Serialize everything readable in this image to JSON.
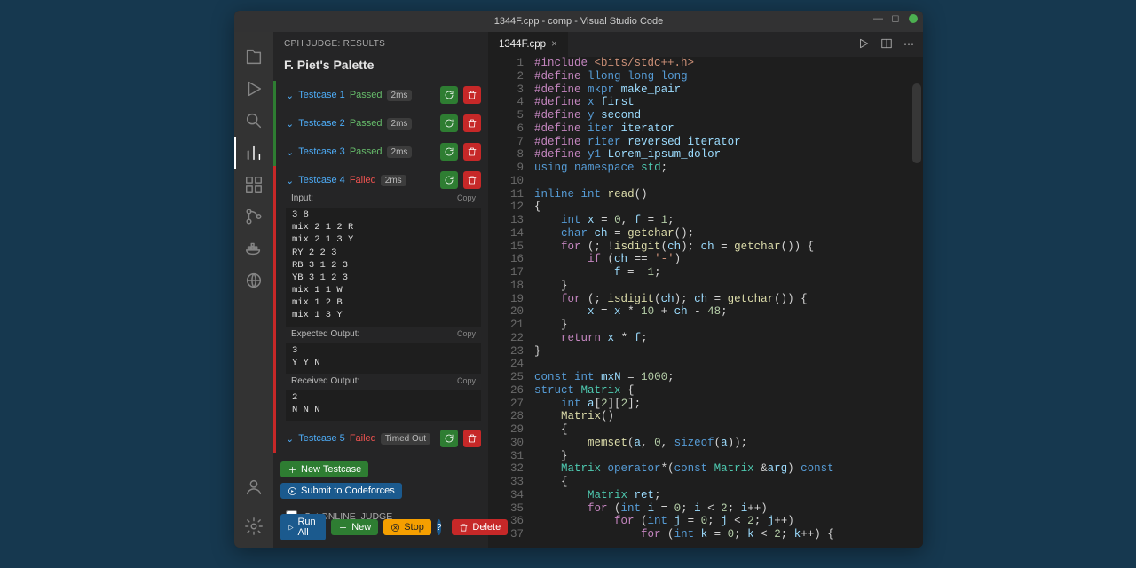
{
  "titlebar": {
    "title": "1344F.cpp - comp - Visual Studio Code"
  },
  "side": {
    "header": "CPH JUDGE: RESULTS",
    "problem": "F. Piet's Palette",
    "testcases": [
      {
        "label": "Testcase 1",
        "status": "Passed",
        "meta": "2ms",
        "pass": true,
        "expanded": false
      },
      {
        "label": "Testcase 2",
        "status": "Passed",
        "meta": "2ms",
        "pass": true,
        "expanded": false
      },
      {
        "label": "Testcase 3",
        "status": "Passed",
        "meta": "2ms",
        "pass": true,
        "expanded": false
      },
      {
        "label": "Testcase 4",
        "status": "Failed",
        "meta": "2ms",
        "pass": false,
        "expanded": true
      },
      {
        "label": "Testcase 5",
        "status": "Failed",
        "meta": "Timed Out",
        "pass": false,
        "expanded": false
      }
    ],
    "tc4": {
      "input_label": "Input:",
      "input": "3 8\nmix 2 1 2 R\nmix 2 1 3 Y\nRY 2 2 3\nRB 3 1 2 3\nYB 3 1 2 3\nmix 1 1 W\nmix 1 2 B\nmix 1 3 Y",
      "expected_label": "Expected Output:",
      "expected": "3\nY Y N",
      "received_label": "Received Output:",
      "received": "2\nN N N",
      "copy": "Copy"
    },
    "new_testcase": "New Testcase",
    "submit": "Submit to Codeforces",
    "checkbox": "Set ONLINE_JUDGE"
  },
  "bottom": {
    "runall": "Run All",
    "new": "New",
    "stop": "Stop",
    "delete": "Delete"
  },
  "tab": {
    "name": "1344F.cpp"
  },
  "code": {
    "lines": [
      [
        {
          "c": "tk-pp",
          "t": "#include"
        },
        {
          "c": "",
          "t": " "
        },
        {
          "c": "tk-st",
          "t": "<bits/stdc++.h>"
        }
      ],
      [
        {
          "c": "tk-pp",
          "t": "#define"
        },
        {
          "c": "",
          "t": " "
        },
        {
          "c": "tk-kw",
          "t": "llong"
        },
        {
          "c": "",
          "t": " "
        },
        {
          "c": "tk-kw",
          "t": "long long"
        }
      ],
      [
        {
          "c": "tk-pp",
          "t": "#define"
        },
        {
          "c": "",
          "t": " "
        },
        {
          "c": "tk-kw",
          "t": "mkpr"
        },
        {
          "c": "",
          "t": " "
        },
        {
          "c": "tk-id",
          "t": "make_pair"
        }
      ],
      [
        {
          "c": "tk-pp",
          "t": "#define"
        },
        {
          "c": "",
          "t": " "
        },
        {
          "c": "tk-kw",
          "t": "x"
        },
        {
          "c": "",
          "t": " "
        },
        {
          "c": "tk-id",
          "t": "first"
        }
      ],
      [
        {
          "c": "tk-pp",
          "t": "#define"
        },
        {
          "c": "",
          "t": " "
        },
        {
          "c": "tk-kw",
          "t": "y"
        },
        {
          "c": "",
          "t": " "
        },
        {
          "c": "tk-id",
          "t": "second"
        }
      ],
      [
        {
          "c": "tk-pp",
          "t": "#define"
        },
        {
          "c": "",
          "t": " "
        },
        {
          "c": "tk-kw",
          "t": "iter"
        },
        {
          "c": "",
          "t": " "
        },
        {
          "c": "tk-id",
          "t": "iterator"
        }
      ],
      [
        {
          "c": "tk-pp",
          "t": "#define"
        },
        {
          "c": "",
          "t": " "
        },
        {
          "c": "tk-kw",
          "t": "riter"
        },
        {
          "c": "",
          "t": " "
        },
        {
          "c": "tk-id",
          "t": "reversed_iterator"
        }
      ],
      [
        {
          "c": "tk-pp",
          "t": "#define"
        },
        {
          "c": "",
          "t": " "
        },
        {
          "c": "tk-kw",
          "t": "y1"
        },
        {
          "c": "",
          "t": " "
        },
        {
          "c": "tk-id",
          "t": "Lorem_ipsum_dolor"
        }
      ],
      [
        {
          "c": "tk-kw",
          "t": "using"
        },
        {
          "c": "",
          "t": " "
        },
        {
          "c": "tk-kw",
          "t": "namespace"
        },
        {
          "c": "",
          "t": " "
        },
        {
          "c": "tk-ty",
          "t": "std"
        },
        {
          "c": "",
          "t": ";"
        }
      ],
      [
        {
          "c": "",
          "t": ""
        }
      ],
      [
        {
          "c": "tk-kw",
          "t": "inline"
        },
        {
          "c": "",
          "t": " "
        },
        {
          "c": "tk-kw",
          "t": "int"
        },
        {
          "c": "",
          "t": " "
        },
        {
          "c": "tk-fn",
          "t": "read"
        },
        {
          "c": "",
          "t": "()"
        }
      ],
      [
        {
          "c": "",
          "t": "{"
        }
      ],
      [
        {
          "c": "",
          "t": "    "
        },
        {
          "c": "tk-kw",
          "t": "int"
        },
        {
          "c": "",
          "t": " "
        },
        {
          "c": "tk-id",
          "t": "x"
        },
        {
          "c": "",
          "t": " = "
        },
        {
          "c": "tk-nm",
          "t": "0"
        },
        {
          "c": "",
          "t": ", "
        },
        {
          "c": "tk-id",
          "t": "f"
        },
        {
          "c": "",
          "t": " = "
        },
        {
          "c": "tk-nm",
          "t": "1"
        },
        {
          "c": "",
          "t": ";"
        }
      ],
      [
        {
          "c": "",
          "t": "    "
        },
        {
          "c": "tk-kw",
          "t": "char"
        },
        {
          "c": "",
          "t": " "
        },
        {
          "c": "tk-id",
          "t": "ch"
        },
        {
          "c": "",
          "t": " = "
        },
        {
          "c": "tk-fn",
          "t": "getchar"
        },
        {
          "c": "",
          "t": "();"
        }
      ],
      [
        {
          "c": "",
          "t": "    "
        },
        {
          "c": "tk-pp",
          "t": "for"
        },
        {
          "c": "",
          "t": " (; !"
        },
        {
          "c": "tk-fn",
          "t": "isdigit"
        },
        {
          "c": "",
          "t": "("
        },
        {
          "c": "tk-id",
          "t": "ch"
        },
        {
          "c": "",
          "t": "); "
        },
        {
          "c": "tk-id",
          "t": "ch"
        },
        {
          "c": "",
          "t": " = "
        },
        {
          "c": "tk-fn",
          "t": "getchar"
        },
        {
          "c": "",
          "t": "()) {"
        }
      ],
      [
        {
          "c": "",
          "t": "        "
        },
        {
          "c": "tk-pp",
          "t": "if"
        },
        {
          "c": "",
          "t": " ("
        },
        {
          "c": "tk-id",
          "t": "ch"
        },
        {
          "c": "",
          "t": " == "
        },
        {
          "c": "tk-st",
          "t": "'-'"
        },
        {
          "c": "",
          "t": ")"
        }
      ],
      [
        {
          "c": "",
          "t": "            "
        },
        {
          "c": "tk-id",
          "t": "f"
        },
        {
          "c": "",
          "t": " = -"
        },
        {
          "c": "tk-nm",
          "t": "1"
        },
        {
          "c": "",
          "t": ";"
        }
      ],
      [
        {
          "c": "",
          "t": "    }"
        }
      ],
      [
        {
          "c": "",
          "t": "    "
        },
        {
          "c": "tk-pp",
          "t": "for"
        },
        {
          "c": "",
          "t": " (; "
        },
        {
          "c": "tk-fn",
          "t": "isdigit"
        },
        {
          "c": "",
          "t": "("
        },
        {
          "c": "tk-id",
          "t": "ch"
        },
        {
          "c": "",
          "t": "); "
        },
        {
          "c": "tk-id",
          "t": "ch"
        },
        {
          "c": "",
          "t": " = "
        },
        {
          "c": "tk-fn",
          "t": "getchar"
        },
        {
          "c": "",
          "t": "()) {"
        }
      ],
      [
        {
          "c": "",
          "t": "        "
        },
        {
          "c": "tk-id",
          "t": "x"
        },
        {
          "c": "",
          "t": " = "
        },
        {
          "c": "tk-id",
          "t": "x"
        },
        {
          "c": "",
          "t": " * "
        },
        {
          "c": "tk-nm",
          "t": "10"
        },
        {
          "c": "",
          "t": " + "
        },
        {
          "c": "tk-id",
          "t": "ch"
        },
        {
          "c": "",
          "t": " - "
        },
        {
          "c": "tk-nm",
          "t": "48"
        },
        {
          "c": "",
          "t": ";"
        }
      ],
      [
        {
          "c": "",
          "t": "    }"
        }
      ],
      [
        {
          "c": "",
          "t": "    "
        },
        {
          "c": "tk-pp",
          "t": "return"
        },
        {
          "c": "",
          "t": " "
        },
        {
          "c": "tk-id",
          "t": "x"
        },
        {
          "c": "",
          "t": " * "
        },
        {
          "c": "tk-id",
          "t": "f"
        },
        {
          "c": "",
          "t": ";"
        }
      ],
      [
        {
          "c": "",
          "t": "}"
        }
      ],
      [
        {
          "c": "",
          "t": ""
        }
      ],
      [
        {
          "c": "tk-kw",
          "t": "const"
        },
        {
          "c": "",
          "t": " "
        },
        {
          "c": "tk-kw",
          "t": "int"
        },
        {
          "c": "",
          "t": " "
        },
        {
          "c": "tk-id",
          "t": "mxN"
        },
        {
          "c": "",
          "t": " = "
        },
        {
          "c": "tk-nm",
          "t": "1000"
        },
        {
          "c": "",
          "t": ";"
        }
      ],
      [
        {
          "c": "tk-kw",
          "t": "struct"
        },
        {
          "c": "",
          "t": " "
        },
        {
          "c": "tk-ty",
          "t": "Matrix"
        },
        {
          "c": "",
          "t": " {"
        }
      ],
      [
        {
          "c": "",
          "t": "    "
        },
        {
          "c": "tk-kw",
          "t": "int"
        },
        {
          "c": "",
          "t": " "
        },
        {
          "c": "tk-id",
          "t": "a"
        },
        {
          "c": "",
          "t": "["
        },
        {
          "c": "tk-nm",
          "t": "2"
        },
        {
          "c": "",
          "t": "]["
        },
        {
          "c": "tk-nm",
          "t": "2"
        },
        {
          "c": "",
          "t": "];"
        }
      ],
      [
        {
          "c": "",
          "t": "    "
        },
        {
          "c": "tk-fn",
          "t": "Matrix"
        },
        {
          "c": "",
          "t": "()"
        }
      ],
      [
        {
          "c": "",
          "t": "    {"
        }
      ],
      [
        {
          "c": "",
          "t": "        "
        },
        {
          "c": "tk-fn",
          "t": "memset"
        },
        {
          "c": "",
          "t": "("
        },
        {
          "c": "tk-id",
          "t": "a"
        },
        {
          "c": "",
          "t": ", "
        },
        {
          "c": "tk-nm",
          "t": "0"
        },
        {
          "c": "",
          "t": ", "
        },
        {
          "c": "tk-kw",
          "t": "sizeof"
        },
        {
          "c": "",
          "t": "("
        },
        {
          "c": "tk-id",
          "t": "a"
        },
        {
          "c": "",
          "t": "));"
        }
      ],
      [
        {
          "c": "",
          "t": "    }"
        }
      ],
      [
        {
          "c": "",
          "t": "    "
        },
        {
          "c": "tk-ty",
          "t": "Matrix"
        },
        {
          "c": "",
          "t": " "
        },
        {
          "c": "tk-kw",
          "t": "operator"
        },
        {
          "c": "",
          "t": "*("
        },
        {
          "c": "tk-kw",
          "t": "const"
        },
        {
          "c": "",
          "t": " "
        },
        {
          "c": "tk-ty",
          "t": "Matrix"
        },
        {
          "c": "",
          "t": " &"
        },
        {
          "c": "tk-id",
          "t": "arg"
        },
        {
          "c": "",
          "t": ") "
        },
        {
          "c": "tk-kw",
          "t": "const"
        }
      ],
      [
        {
          "c": "",
          "t": "    {"
        }
      ],
      [
        {
          "c": "",
          "t": "        "
        },
        {
          "c": "tk-ty",
          "t": "Matrix"
        },
        {
          "c": "",
          "t": " "
        },
        {
          "c": "tk-id",
          "t": "ret"
        },
        {
          "c": "",
          "t": ";"
        }
      ],
      [
        {
          "c": "",
          "t": "        "
        },
        {
          "c": "tk-pp",
          "t": "for"
        },
        {
          "c": "",
          "t": " ("
        },
        {
          "c": "tk-kw",
          "t": "int"
        },
        {
          "c": "",
          "t": " "
        },
        {
          "c": "tk-id",
          "t": "i"
        },
        {
          "c": "",
          "t": " = "
        },
        {
          "c": "tk-nm",
          "t": "0"
        },
        {
          "c": "",
          "t": "; "
        },
        {
          "c": "tk-id",
          "t": "i"
        },
        {
          "c": "",
          "t": " < "
        },
        {
          "c": "tk-nm",
          "t": "2"
        },
        {
          "c": "",
          "t": "; "
        },
        {
          "c": "tk-id",
          "t": "i"
        },
        {
          "c": "",
          "t": "++)"
        }
      ],
      [
        {
          "c": "",
          "t": "            "
        },
        {
          "c": "tk-pp",
          "t": "for"
        },
        {
          "c": "",
          "t": " ("
        },
        {
          "c": "tk-kw",
          "t": "int"
        },
        {
          "c": "",
          "t": " "
        },
        {
          "c": "tk-id",
          "t": "j"
        },
        {
          "c": "",
          "t": " = "
        },
        {
          "c": "tk-nm",
          "t": "0"
        },
        {
          "c": "",
          "t": "; "
        },
        {
          "c": "tk-id",
          "t": "j"
        },
        {
          "c": "",
          "t": " < "
        },
        {
          "c": "tk-nm",
          "t": "2"
        },
        {
          "c": "",
          "t": "; "
        },
        {
          "c": "tk-id",
          "t": "j"
        },
        {
          "c": "",
          "t": "++)"
        }
      ],
      [
        {
          "c": "",
          "t": "                "
        },
        {
          "c": "tk-pp",
          "t": "for"
        },
        {
          "c": "",
          "t": " ("
        },
        {
          "c": "tk-kw",
          "t": "int"
        },
        {
          "c": "",
          "t": " "
        },
        {
          "c": "tk-id",
          "t": "k"
        },
        {
          "c": "",
          "t": " = "
        },
        {
          "c": "tk-nm",
          "t": "0"
        },
        {
          "c": "",
          "t": "; "
        },
        {
          "c": "tk-id",
          "t": "k"
        },
        {
          "c": "",
          "t": " < "
        },
        {
          "c": "tk-nm",
          "t": "2"
        },
        {
          "c": "",
          "t": "; "
        },
        {
          "c": "tk-id",
          "t": "k"
        },
        {
          "c": "",
          "t": "++) {"
        }
      ]
    ]
  }
}
